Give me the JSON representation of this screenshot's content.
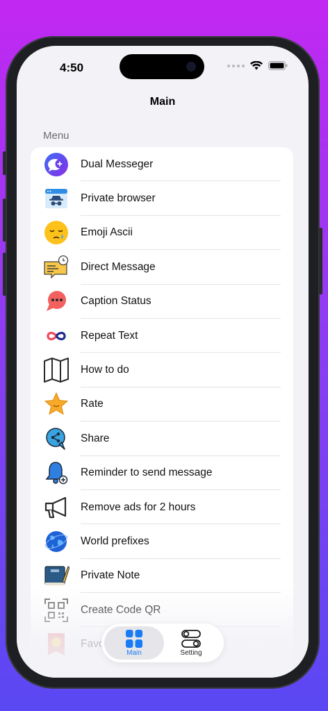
{
  "status_bar": {
    "time": "4:50"
  },
  "nav": {
    "title": "Main"
  },
  "menu": {
    "header": "Menu",
    "items": [
      {
        "label": "Dual Messeger",
        "icon": "dual-messenger-icon"
      },
      {
        "label": "Private browser",
        "icon": "incognito-browser-icon"
      },
      {
        "label": "Emoji Ascii",
        "icon": "sleepy-emoji-icon"
      },
      {
        "label": "Direct Message",
        "icon": "direct-message-icon"
      },
      {
        "label": "Caption Status",
        "icon": "chat-bubble-icon"
      },
      {
        "label": "Repeat Text",
        "icon": "infinity-icon"
      },
      {
        "label": "How to do",
        "icon": "map-icon"
      },
      {
        "label": "Rate",
        "icon": "star-icon"
      },
      {
        "label": "Share",
        "icon": "share-icon"
      },
      {
        "label": "Reminder to send message",
        "icon": "bell-icon"
      },
      {
        "label": "Remove ads for 2 hours",
        "icon": "megaphone-icon"
      },
      {
        "label": "World prefixes",
        "icon": "globe-icon"
      },
      {
        "label": "Private Note",
        "icon": "notebook-icon"
      },
      {
        "label": "Create Code QR",
        "icon": "qr-code-icon"
      },
      {
        "label": "Favo",
        "icon": "favorite-badge-icon"
      }
    ]
  },
  "tabbar": {
    "tabs": [
      {
        "label": "Main",
        "icon": "grid-icon",
        "active": true
      },
      {
        "label": "Setting",
        "icon": "toggles-icon",
        "active": false
      }
    ]
  },
  "colors": {
    "accent": "#1a7cf5",
    "background": "#f2f2f7"
  }
}
